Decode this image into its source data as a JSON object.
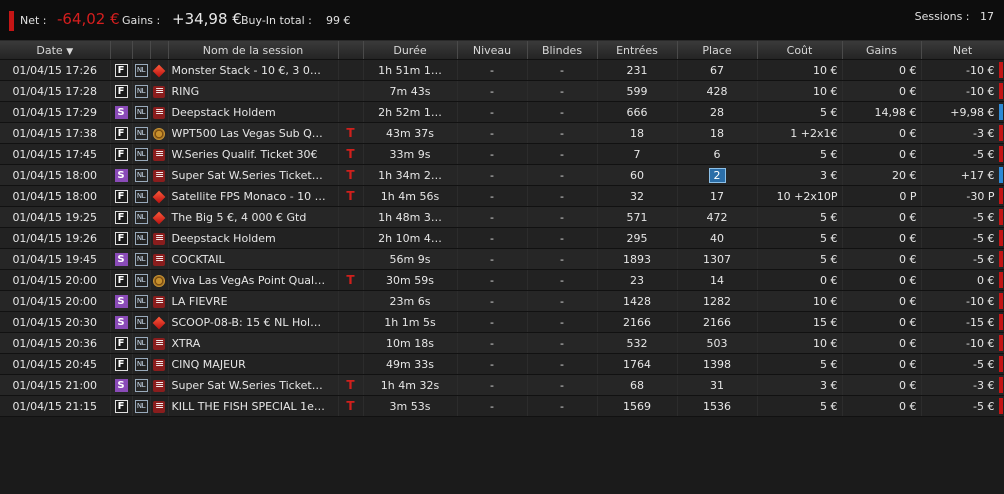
{
  "summary": {
    "net_label": "Net :",
    "net_value": "-64,02 €",
    "gains_label": "Gains :",
    "gains_value": "+34,98 €",
    "buyin_label": "Buy-In total :",
    "buyin_value": "99 €",
    "sessions_label": "Sessions :",
    "sessions_value": "17"
  },
  "columns": {
    "date": "Date",
    "name": "Nom de la session",
    "duration": "Durée",
    "level": "Niveau",
    "blinds": "Blindes",
    "entries": "Entrées",
    "place": "Place",
    "cost": "Coût",
    "gains": "Gains",
    "net": "Net"
  },
  "sort_indicator": "▼",
  "rows": [
    {
      "date": "01/04/15 17:26",
      "type": "F",
      "nl": "NL",
      "room": "pokerstars",
      "name": "Monster Stack - 10 €, 3 0…",
      "ticket": "",
      "duration": "1h 51m 1…",
      "level": "-",
      "blinds": "-",
      "entries": "231",
      "place": "67",
      "place_hl": false,
      "cost": "10 €",
      "gains": "0 €",
      "net": "-10 €",
      "result": "loss"
    },
    {
      "date": "01/04/15 17:28",
      "type": "F",
      "nl": "NL",
      "room": "site",
      "name": "RING",
      "ticket": "",
      "duration": "7m 43s",
      "level": "-",
      "blinds": "-",
      "entries": "599",
      "place": "428",
      "place_hl": false,
      "cost": "10 €",
      "gains": "0 €",
      "net": "-10 €",
      "result": "loss"
    },
    {
      "date": "01/04/15 17:29",
      "type": "S",
      "nl": "NL",
      "room": "site",
      "name": "Deepstack Holdem",
      "ticket": "",
      "duration": "2h 52m 1…",
      "level": "-",
      "blinds": "-",
      "entries": "666",
      "place": "28",
      "place_hl": false,
      "cost": "5 €",
      "gains": "14,98 €",
      "net": "+9,98 €",
      "result": "win"
    },
    {
      "date": "01/04/15 17:38",
      "type": "F",
      "nl": "NL",
      "room": "winamax",
      "name": "WPT500 Las Vegas Sub Q…",
      "ticket": "T",
      "duration": "43m 37s",
      "level": "-",
      "blinds": "-",
      "entries": "18",
      "place": "18",
      "place_hl": false,
      "cost": "1  +2x1€",
      "gains": "0 €",
      "net": "-3 €",
      "result": "loss"
    },
    {
      "date": "01/04/15 17:45",
      "type": "F",
      "nl": "NL",
      "room": "site",
      "name": "W.Series Qualif. Ticket 30€",
      "ticket": "T",
      "duration": "33m 9s",
      "level": "-",
      "blinds": "-",
      "entries": "7",
      "place": "6",
      "place_hl": false,
      "cost": "5 €",
      "gains": "0 €",
      "net": "-5 €",
      "result": "loss"
    },
    {
      "date": "01/04/15 18:00",
      "type": "S",
      "nl": "NL",
      "room": "site",
      "name": "Super Sat W.Series Ticket…",
      "ticket": "T",
      "duration": "1h 34m 2…",
      "level": "-",
      "blinds": "-",
      "entries": "60",
      "place": "2",
      "place_hl": true,
      "cost": "3 €",
      "gains": "20 €",
      "net": "+17 €",
      "result": "win"
    },
    {
      "date": "01/04/15 18:00",
      "type": "F",
      "nl": "NL",
      "room": "pokerstars",
      "name": "Satellite FPS Monaco - 10 …",
      "ticket": "T",
      "duration": "1h 4m 56s",
      "level": "-",
      "blinds": "-",
      "entries": "32",
      "place": "17",
      "place_hl": false,
      "cost": "10  +2x10P",
      "gains": "0 P",
      "net": "-30 P",
      "result": "loss"
    },
    {
      "date": "01/04/15 19:25",
      "type": "F",
      "nl": "NL",
      "room": "pokerstars",
      "name": "The Big 5 €, 4 000 € Gtd",
      "ticket": "",
      "duration": "1h 48m 3…",
      "level": "-",
      "blinds": "-",
      "entries": "571",
      "place": "472",
      "place_hl": false,
      "cost": "5 €",
      "gains": "0 €",
      "net": "-5 €",
      "result": "loss"
    },
    {
      "date": "01/04/15 19:26",
      "type": "F",
      "nl": "NL",
      "room": "site",
      "name": "Deepstack Holdem",
      "ticket": "",
      "duration": "2h 10m 4…",
      "level": "-",
      "blinds": "-",
      "entries": "295",
      "place": "40",
      "place_hl": false,
      "cost": "5 €",
      "gains": "0 €",
      "net": "-5 €",
      "result": "loss"
    },
    {
      "date": "01/04/15 19:45",
      "type": "S",
      "nl": "NL",
      "room": "site",
      "name": "COCKTAIL",
      "ticket": "",
      "duration": "56m 9s",
      "level": "-",
      "blinds": "-",
      "entries": "1893",
      "place": "1307",
      "place_hl": false,
      "cost": "5 €",
      "gains": "0 €",
      "net": "-5 €",
      "result": "loss"
    },
    {
      "date": "01/04/15 20:00",
      "type": "F",
      "nl": "NL",
      "room": "winamax",
      "name": "Viva Las VegAs Point Qual…",
      "ticket": "T",
      "duration": "30m 59s",
      "level": "-",
      "blinds": "-",
      "entries": "23",
      "place": "14",
      "place_hl": false,
      "cost": "0 €",
      "gains": "0 €",
      "net": "0 €",
      "result": "loss"
    },
    {
      "date": "01/04/15 20:00",
      "type": "S",
      "nl": "NL",
      "room": "site",
      "name": "LA FIEVRE",
      "ticket": "",
      "duration": "23m 6s",
      "level": "-",
      "blinds": "-",
      "entries": "1428",
      "place": "1282",
      "place_hl": false,
      "cost": "10 €",
      "gains": "0 €",
      "net": "-10 €",
      "result": "loss"
    },
    {
      "date": "01/04/15 20:30",
      "type": "S",
      "nl": "NL",
      "room": "pokerstars",
      "name": "SCOOP-08-B: 15 € NL Hol…",
      "ticket": "",
      "duration": "1h 1m 5s",
      "level": "-",
      "blinds": "-",
      "entries": "2166",
      "place": "2166",
      "place_hl": false,
      "cost": "15 €",
      "gains": "0 €",
      "net": "-15 €",
      "result": "loss"
    },
    {
      "date": "01/04/15 20:36",
      "type": "F",
      "nl": "NL",
      "room": "site",
      "name": "XTRA",
      "ticket": "",
      "duration": "10m 18s",
      "level": "-",
      "blinds": "-",
      "entries": "532",
      "place": "503",
      "place_hl": false,
      "cost": "10 €",
      "gains": "0 €",
      "net": "-10 €",
      "result": "loss"
    },
    {
      "date": "01/04/15 20:45",
      "type": "F",
      "nl": "NL",
      "room": "site",
      "name": "CINQ MAJEUR",
      "ticket": "",
      "duration": "49m 33s",
      "level": "-",
      "blinds": "-",
      "entries": "1764",
      "place": "1398",
      "place_hl": false,
      "cost": "5 €",
      "gains": "0 €",
      "net": "-5 €",
      "result": "loss"
    },
    {
      "date": "01/04/15 21:00",
      "type": "S",
      "nl": "NL",
      "room": "site",
      "name": "Super Sat W.Series Ticket…",
      "ticket": "T",
      "duration": "1h 4m 32s",
      "level": "-",
      "blinds": "-",
      "entries": "68",
      "place": "31",
      "place_hl": false,
      "cost": "3 €",
      "gains": "0 €",
      "net": "-3 €",
      "result": "loss"
    },
    {
      "date": "01/04/15 21:15",
      "type": "F",
      "nl": "NL",
      "room": "site",
      "name": "KILL THE FISH SPECIAL 1e…",
      "ticket": "T",
      "duration": "3m 53s",
      "level": "-",
      "blinds": "-",
      "entries": "1569",
      "place": "1536",
      "place_hl": false,
      "cost": "5 €",
      "gains": "0 €",
      "net": "-5 €",
      "result": "loss"
    }
  ],
  "colors": {
    "loss": "#c41515",
    "win": "#2d8ad6",
    "speed_S": "#8a4bb8"
  }
}
